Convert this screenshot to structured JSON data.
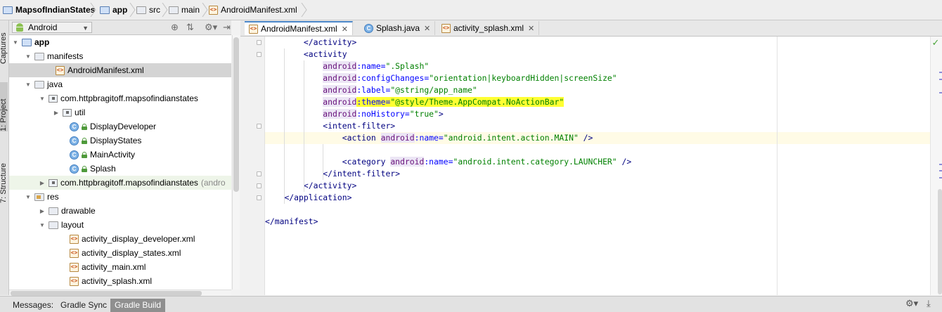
{
  "breadcrumb": [
    {
      "label": "MapsofIndianStates",
      "icon": "project-folder-icon"
    },
    {
      "label": "app",
      "icon": "module-folder-icon"
    },
    {
      "label": "src",
      "icon": "folder-icon"
    },
    {
      "label": "main",
      "icon": "folder-icon"
    },
    {
      "label": "AndroidManifest.xml",
      "icon": "xml-file-icon"
    }
  ],
  "left_tool_tabs": [
    "Captures",
    "1: Project",
    "7: Structure"
  ],
  "project_panel": {
    "view_selector": "Android",
    "header_icons": [
      "target-icon",
      "collapse-icon",
      "gear-icon",
      "hide-icon"
    ]
  },
  "tree": [
    {
      "label": "app",
      "level": 0,
      "expanded": true,
      "icon": "module",
      "bold": true
    },
    {
      "label": "manifests",
      "level": 1,
      "expanded": true,
      "icon": "folder"
    },
    {
      "label": "AndroidManifest.xml",
      "level": 2,
      "icon": "xml",
      "selected": true
    },
    {
      "label": "java",
      "level": 1,
      "expanded": true,
      "icon": "folder"
    },
    {
      "label": "com.httpbragitoff.mapsofindianstates",
      "level": 2,
      "expanded": true,
      "icon": "package"
    },
    {
      "label": "util",
      "level": 3,
      "expanded": false,
      "icon": "package"
    },
    {
      "label": "DisplayDeveloper",
      "level": 3,
      "icon": "class"
    },
    {
      "label": "DisplayStates",
      "level": 3,
      "icon": "class"
    },
    {
      "label": "MainActivity",
      "level": 3,
      "icon": "class"
    },
    {
      "label": "Splash",
      "level": 3,
      "icon": "class"
    },
    {
      "label": "com.httpbragitoff.mapsofindianstates",
      "level": 2,
      "expanded": false,
      "icon": "package",
      "suffix": "(andro",
      "modified": true
    },
    {
      "label": "res",
      "level": 1,
      "expanded": true,
      "icon": "res-folder"
    },
    {
      "label": "drawable",
      "level": 2,
      "expanded": false,
      "icon": "folder"
    },
    {
      "label": "layout",
      "level": 2,
      "expanded": true,
      "icon": "folder"
    },
    {
      "label": "activity_display_developer.xml",
      "level": 3,
      "icon": "xml"
    },
    {
      "label": "activity_display_states.xml",
      "level": 3,
      "icon": "xml"
    },
    {
      "label": "activity_main.xml",
      "level": 3,
      "icon": "xml"
    },
    {
      "label": "activity_splash.xml",
      "level": 3,
      "icon": "xml"
    }
  ],
  "editor_tabs": [
    {
      "label": "AndroidManifest.xml",
      "icon": "xml-file-icon",
      "active": true,
      "highlighted": true
    },
    {
      "label": "Splash.java",
      "icon": "class-icon",
      "active": false
    },
    {
      "label": "activity_splash.xml",
      "icon": "xml-file-icon",
      "active": false
    }
  ],
  "code": [
    {
      "indent": "        ",
      "tokens": [
        [
          "tg",
          "</activity>"
        ]
      ]
    },
    {
      "indent": "        ",
      "tokens": [
        [
          "tg",
          "<activity"
        ]
      ]
    },
    {
      "indent": "            ",
      "tokens": [
        [
          "an",
          "android"
        ],
        [
          "at",
          ":name="
        ],
        [
          "st",
          "\".Splash\""
        ]
      ]
    },
    {
      "indent": "            ",
      "tokens": [
        [
          "an",
          "android"
        ],
        [
          "at",
          ":configChanges="
        ],
        [
          "st",
          "\"orientation|keyboardHidden|screenSize\""
        ]
      ]
    },
    {
      "indent": "            ",
      "tokens": [
        [
          "an",
          "android"
        ],
        [
          "at",
          ":label="
        ],
        [
          "st",
          "\"@string/app_name\""
        ]
      ]
    },
    {
      "indent": "            ",
      "highlight": true,
      "tokens": [
        [
          "an",
          "android"
        ],
        [
          "at",
          ":theme="
        ],
        [
          "st",
          "\"@style/Theme.AppCompat.NoActionBar\""
        ]
      ]
    },
    {
      "indent": "            ",
      "tokens": [
        [
          "an",
          "android"
        ],
        [
          "at",
          ":noHistory="
        ],
        [
          "st",
          "\"true\""
        ],
        [
          "tg",
          ">"
        ]
      ]
    },
    {
      "indent": "            ",
      "tokens": [
        [
          "tg",
          "<intent-filter>"
        ]
      ]
    },
    {
      "indent": "                ",
      "current": true,
      "tokens": [
        [
          "tg",
          "<action "
        ],
        [
          "an",
          "android"
        ],
        [
          "at",
          ":name="
        ],
        [
          "st",
          "\"android.intent.action.MAIN\""
        ],
        [
          "tg",
          " />"
        ]
      ]
    },
    {
      "indent": "",
      "tokens": []
    },
    {
      "indent": "                ",
      "tokens": [
        [
          "tg",
          "<category "
        ],
        [
          "an",
          "android"
        ],
        [
          "at",
          ":name="
        ],
        [
          "st",
          "\"android.intent.category.LAUNCHER\""
        ],
        [
          "tg",
          " />"
        ]
      ]
    },
    {
      "indent": "            ",
      "tokens": [
        [
          "tg",
          "</intent-filter>"
        ]
      ]
    },
    {
      "indent": "        ",
      "tokens": [
        [
          "tg",
          "</activity>"
        ]
      ]
    },
    {
      "indent": "    ",
      "tokens": [
        [
          "tg",
          "</application>"
        ]
      ]
    },
    {
      "indent": "",
      "tokens": []
    },
    {
      "indent": "",
      "tokens": [
        [
          "tg",
          "</manifest>"
        ]
      ]
    }
  ],
  "bottom_tabs": [
    {
      "label": "Messages:",
      "active": false
    },
    {
      "label": "Gradle Sync",
      "active": false
    },
    {
      "label": "Gradle Build",
      "active": true
    }
  ],
  "colors": {
    "highlight": "#ffff66",
    "tag": "#000080",
    "attr": "#0000ff",
    "string": "#008000",
    "namespace": "#660e7a"
  }
}
